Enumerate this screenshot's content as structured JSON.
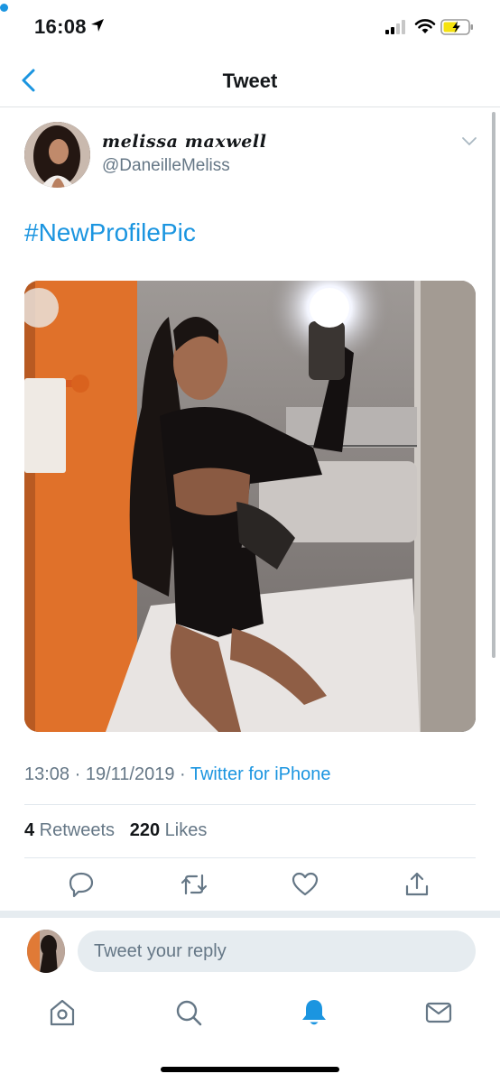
{
  "status_bar": {
    "time": "16:08"
  },
  "nav": {
    "title": "Tweet"
  },
  "tweet": {
    "author_name": "melissa maxwell",
    "author_handle": "@DaneilleMeliss",
    "text": "#NewProfilePic",
    "timestamp": "13:08 · 19/11/2019 · ",
    "source": "Twitter for iPhone",
    "retweets_count": "4",
    "retweets_label": " Retweets",
    "likes_count": "220",
    "likes_label": " Likes"
  },
  "reply": {
    "placeholder": "Tweet your reply"
  },
  "icons": {
    "status": [
      "location-arrow-icon",
      "cellular-signal-icon",
      "wifi-icon",
      "battery-charging-icon"
    ],
    "nav": [
      "back-chevron-icon"
    ],
    "tweet": [
      "caret-down-icon"
    ],
    "actions": [
      "reply-icon",
      "retweet-icon",
      "like-icon",
      "share-icon"
    ],
    "tabs": [
      "home-icon",
      "search-icon",
      "notifications-icon",
      "messages-icon"
    ]
  },
  "colors": {
    "accent": "#1b95e0",
    "secondary_text": "#657786",
    "battery_charging": "#f5e20f",
    "divider": "#e1e8ed"
  }
}
